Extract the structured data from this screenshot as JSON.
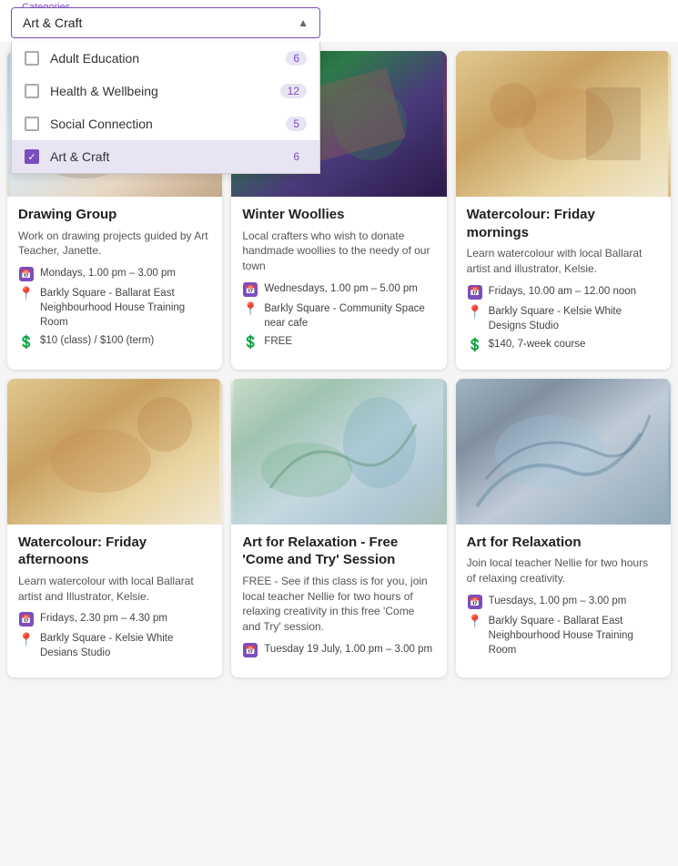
{
  "header": {
    "categories_label": "Categories",
    "selected_value": "Art & Craft",
    "dropdown": {
      "items": [
        {
          "id": "adult-education",
          "label": "Adult Education",
          "count": 6,
          "selected": false
        },
        {
          "id": "health-wellbeing",
          "label": "Health & Wellbeing",
          "count": 12,
          "selected": false
        },
        {
          "id": "social-connection",
          "label": "Social Connection",
          "count": 5,
          "selected": false
        },
        {
          "id": "art-craft",
          "label": "Art & Craft",
          "count": 6,
          "selected": true
        }
      ]
    }
  },
  "cards": [
    {
      "id": "drawing-group",
      "title": "Drawing Group",
      "description": "Work on drawing projects guided by Art Teacher, Janette.",
      "schedule": "Mondays, 1.00 pm – 3.00 pm",
      "location": "Barkly Square - Ballarat East Neighbourhood House Training Room",
      "cost": "$10 (class) / $100 (term)"
    },
    {
      "id": "winter-woollies",
      "title": "Winter Woollies",
      "description": "Local crafters who wish to donate handmade woollies to the needy of our town",
      "schedule": "Wednesdays, 1.00 pm – 5.00 pm",
      "location": "Barkly Square - Community Space near cafe",
      "cost": "FREE"
    },
    {
      "id": "watercolour-friday-mornings",
      "title": "Watercolour: Friday mornings",
      "description": "Learn watercolour with local Ballarat artist and illustrator, Kelsie.",
      "schedule": "Fridays, 10.00 am – 12.00 noon",
      "location": "Barkly Square - Kelsie White Designs Studio",
      "cost": "$140, 7-week course"
    },
    {
      "id": "watercolour-friday-afternoons",
      "title": "Watercolour: Friday afternoons",
      "description": "Learn watercolour with local Ballarat artist and Illustrator, Kelsie.",
      "schedule": "Fridays, 2.30 pm – 4.30 pm",
      "location": "Barkly Square - Kelsie White Desians Studio",
      "cost": null
    },
    {
      "id": "art-relaxation-free",
      "title": "Art for Relaxation - Free 'Come and Try' Session",
      "description": "FREE - See if this class is for you, join local teacher Nellie for two hours of relaxing creativity in this free 'Come and Try' session.",
      "schedule": "Tuesday 19 July, 1.00 pm – 3.00 pm",
      "location": null,
      "cost": null
    },
    {
      "id": "art-relaxation",
      "title": "Art for Relaxation",
      "description": "Join local teacher Nellie for two hours of relaxing creativity.",
      "schedule": "Tuesdays, 1.00 pm – 3.00 pm",
      "location": "Barkly Square - Ballarat East Neighbourhood House Training Room",
      "cost": null
    }
  ]
}
